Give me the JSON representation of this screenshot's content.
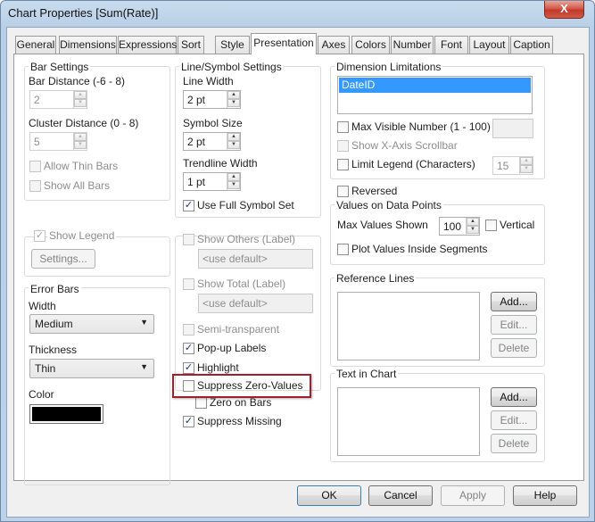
{
  "window": {
    "title": "Chart Properties [Sum(Rate)]",
    "close_glyph": "X"
  },
  "tabs": [
    {
      "label": "General"
    },
    {
      "label": "Dimensions"
    },
    {
      "label": "Expressions"
    },
    {
      "label": "Sort"
    },
    {
      "label": "Style"
    },
    {
      "label": "Presentation"
    },
    {
      "label": "Axes"
    },
    {
      "label": "Colors"
    },
    {
      "label": "Number"
    },
    {
      "label": "Font"
    },
    {
      "label": "Layout"
    },
    {
      "label": "Caption"
    }
  ],
  "active_tab": "Presentation",
  "bar_settings": {
    "title": "Bar Settings",
    "bar_distance_label": "Bar Distance (-6 - 8)",
    "bar_distance_value": "2",
    "cluster_distance_label": "Cluster Distance (0 - 8)",
    "cluster_distance_value": "5",
    "allow_thin_bars": {
      "label": "Allow Thin Bars",
      "checked": false
    },
    "show_all_bars": {
      "label": "Show All Bars",
      "checked": false
    }
  },
  "legend": {
    "show_legend": {
      "label": "Show Legend",
      "checked": true
    },
    "settings_button": "Settings..."
  },
  "error_bars": {
    "title": "Error Bars",
    "width_label": "Width",
    "width_value": "Medium",
    "thickness_label": "Thickness",
    "thickness_value": "Thin",
    "color_label": "Color",
    "color_value": "#000000"
  },
  "line_symbol": {
    "title": "Line/Symbol Settings",
    "line_width_label": "Line Width",
    "line_width_value": "2 pt",
    "symbol_size_label": "Symbol Size",
    "symbol_size_value": "2 pt",
    "trendline_width_label": "Trendline Width",
    "trendline_width_value": "1 pt",
    "use_full_symbol_set": {
      "label": "Use Full Symbol Set",
      "checked": true
    }
  },
  "options": {
    "show_others": {
      "label": "Show Others (Label)",
      "checked": false,
      "placeholder": "<use default>"
    },
    "show_total": {
      "label": "Show Total (Label)",
      "checked": false,
      "placeholder": "<use default>"
    },
    "semi_transparent": {
      "label": "Semi-transparent",
      "checked": false
    },
    "popup_labels": {
      "label": "Pop-up Labels",
      "checked": true
    },
    "highlight": {
      "label": "Highlight",
      "checked": true
    },
    "suppress_zero_values": {
      "label": "Suppress Zero-Values",
      "checked": false
    },
    "zero_on_bars": {
      "label": "Zero on Bars",
      "checked": false
    },
    "suppress_missing": {
      "label": "Suppress Missing",
      "checked": true
    }
  },
  "dimension_limitations": {
    "title": "Dimension Limitations",
    "items": [
      "DateID"
    ],
    "max_visible": {
      "label": "Max Visible Number (1 - 100)",
      "checked": false,
      "value": ""
    },
    "show_x_scrollbar": {
      "label": "Show X-Axis Scrollbar",
      "checked": false
    },
    "limit_legend": {
      "label": "Limit Legend (Characters)",
      "checked": false,
      "value": "15"
    }
  },
  "reversed": {
    "label": "Reversed",
    "checked": false
  },
  "values_on_points": {
    "title": "Values on Data Points",
    "max_values_label": "Max Values Shown",
    "max_values_value": "100",
    "vertical": {
      "label": "Vertical",
      "checked": false
    },
    "plot_inside": {
      "label": "Plot Values Inside Segments",
      "checked": false
    }
  },
  "reference_lines": {
    "title": "Reference Lines",
    "add": "Add...",
    "edit": "Edit...",
    "delete": "Delete"
  },
  "text_in_chart": {
    "title": "Text in Chart",
    "add": "Add...",
    "edit": "Edit...",
    "delete": "Delete"
  },
  "footer": {
    "ok": "OK",
    "cancel": "Cancel",
    "apply": "Apply",
    "help": "Help"
  },
  "check_glyph": "✓",
  "colors": {
    "annotation_box": "#a31f2a",
    "selection": "#3399ff"
  }
}
